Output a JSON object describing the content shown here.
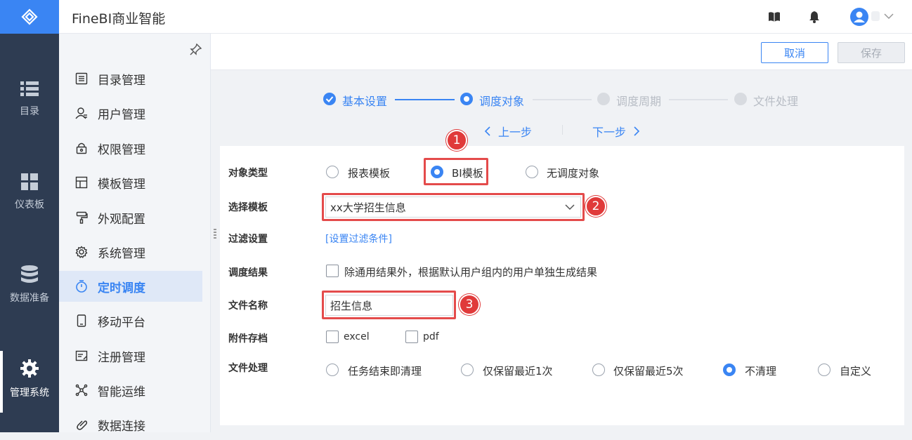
{
  "header": {
    "title": "FineBI商业智能"
  },
  "rail": {
    "items": [
      {
        "label": "目录",
        "icon": "list-icon"
      },
      {
        "label": "仪表板",
        "icon": "dashboard-grid-icon"
      },
      {
        "label": "数据准备",
        "icon": "database-icon"
      },
      {
        "label": "管理系统",
        "icon": "gear-icon"
      }
    ],
    "active": "管理系统"
  },
  "subnav": {
    "items": [
      {
        "label": "目录管理",
        "icon": "catalog-icon"
      },
      {
        "label": "用户管理",
        "icon": "user-icon"
      },
      {
        "label": "权限管理",
        "icon": "lock-icon"
      },
      {
        "label": "模板管理",
        "icon": "template-icon"
      },
      {
        "label": "外观配置",
        "icon": "paint-roller-icon"
      },
      {
        "label": "系统管理",
        "icon": "settings-icon"
      },
      {
        "label": "定时调度",
        "icon": "timer-icon"
      },
      {
        "label": "移动平台",
        "icon": "mobile-icon"
      },
      {
        "label": "注册管理",
        "icon": "register-icon"
      },
      {
        "label": "智能运维",
        "icon": "ops-network-icon"
      },
      {
        "label": "数据连接",
        "icon": "link-icon"
      }
    ],
    "active": "定时调度"
  },
  "toolbar": {
    "cancel_label": "取消",
    "save_label": "保存"
  },
  "steps": {
    "items": [
      {
        "label": "基本设置",
        "state": "done"
      },
      {
        "label": "调度对象",
        "state": "current"
      },
      {
        "label": "调度周期",
        "state": "todo"
      },
      {
        "label": "文件处理",
        "state": "todo"
      }
    ],
    "prev_label": "上一步",
    "next_label": "下一步"
  },
  "form": {
    "object_type": {
      "label": "对象类型",
      "options": [
        "报表模板",
        "BI模板",
        "无调度对象"
      ],
      "selected": "BI模板"
    },
    "template": {
      "label": "选择模板",
      "value": "xx大学招生信息"
    },
    "filter": {
      "label": "过滤设置",
      "link": "[设置过滤条件]"
    },
    "result": {
      "label": "调度结果",
      "checkbox_text": "除通用结果外，根据默认用户组内的用户单独生成结果",
      "checked": false
    },
    "file_name": {
      "label": "文件名称",
      "value": "招生信息"
    },
    "attachment": {
      "label": "附件存档",
      "options": [
        "excel",
        "pdf"
      ]
    },
    "file_handling": {
      "label": "文件处理",
      "options": [
        "任务结束即清理",
        "仅保留最近1次",
        "仅保留最近5次",
        "不清理",
        "自定义"
      ],
      "selected": "不清理"
    }
  },
  "annotations": [
    "1",
    "2",
    "3"
  ],
  "colors": {
    "accent": "#3a85f3",
    "rail": "#2e3c52",
    "highlight": "#e44b4b"
  }
}
